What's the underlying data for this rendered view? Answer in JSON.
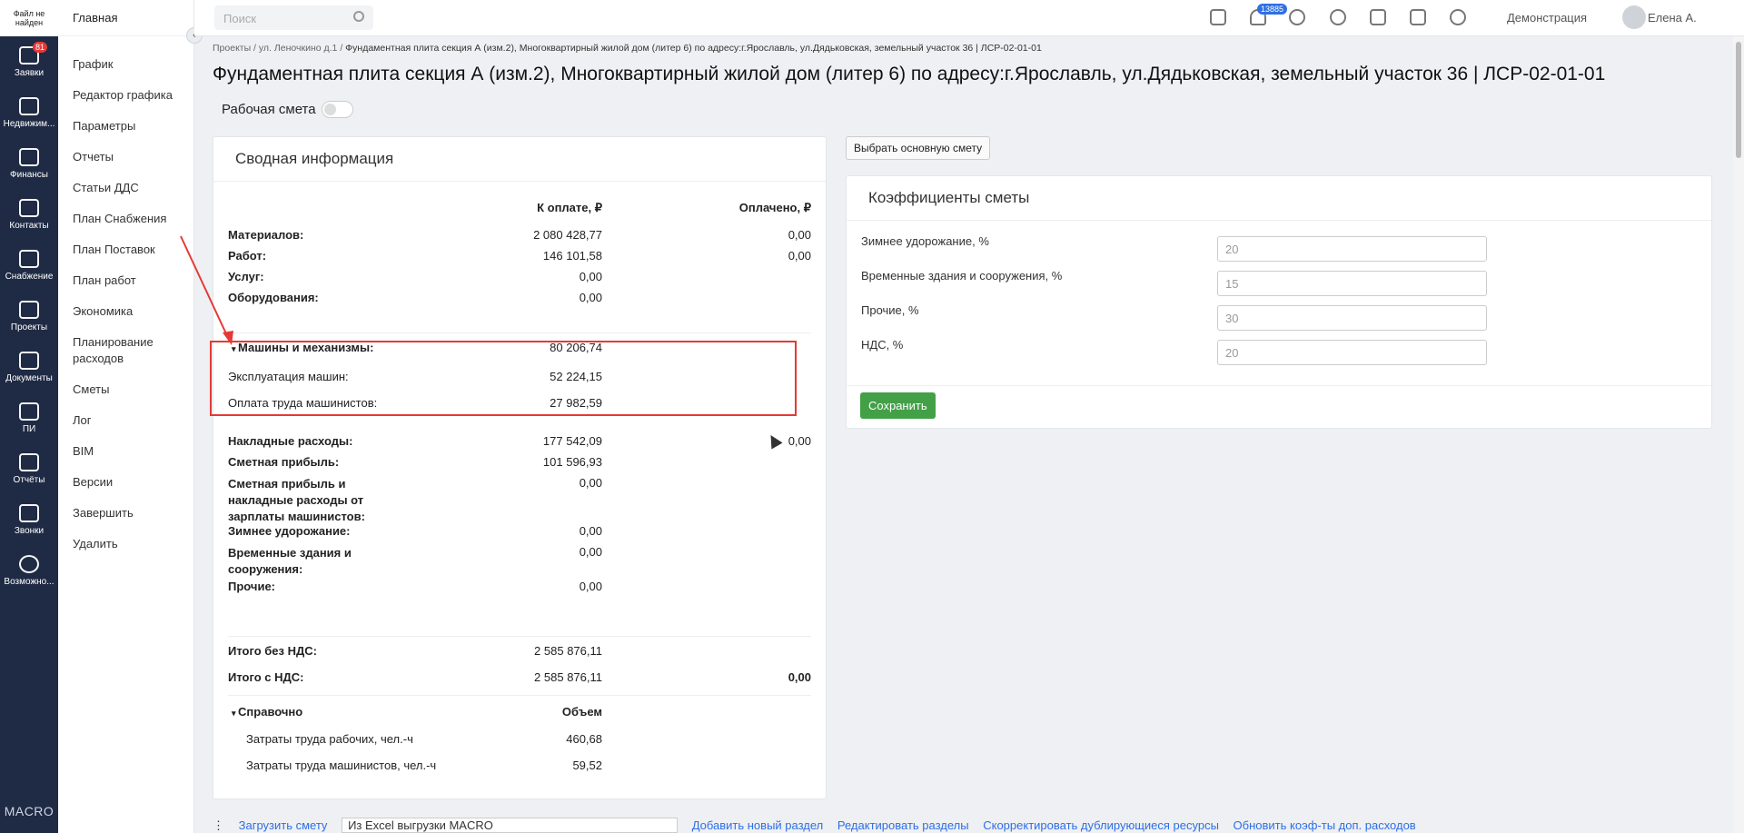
{
  "rail": {
    "file_notice": "Файл не найден",
    "items": [
      {
        "label": "Заявки",
        "badge": "81"
      },
      {
        "label": "Недвижим..."
      },
      {
        "label": "Финансы"
      },
      {
        "label": "Контакты"
      },
      {
        "label": "Снабжение"
      },
      {
        "label": "Проекты"
      },
      {
        "label": "Документы"
      },
      {
        "label": "ПИ"
      },
      {
        "label": "Отчёты"
      },
      {
        "label": "Звонки"
      },
      {
        "label": "Возможно..."
      }
    ],
    "brand": "MACRO"
  },
  "sidebar": {
    "title": "Главная",
    "items": [
      "График",
      "Редактор графика",
      "Параметры",
      "Отчеты",
      "Статьи ДДС",
      "План Снабжения",
      "План Поставок",
      "План работ",
      "Экономика",
      "Планирование расходов",
      "Сметы",
      "Лог",
      "BIM",
      "Версии",
      "Завершить",
      "Удалить"
    ]
  },
  "topbar": {
    "search_placeholder": "Поиск",
    "notif_count": "13885",
    "org": "Демонстрация",
    "user": "Елена А."
  },
  "breadcrumb": {
    "items": [
      "Проекты",
      "ул. Леночкино д.1",
      "Фундаментная плита секция А (изм.2), Многоквартирный жилой дом (литер 6) по адресу:г.Ярославль, ул.Дядьковская, земельный участок 36 | ЛСР-02-01-01"
    ]
  },
  "page_title": "Фундаментная плита секция А (изм.2), Многоквартирный жилой дом (литер 6) по адресу:г.Ярославль, ул.Дядьковская, земельный участок 36 | ЛСР-02-01-01",
  "working_estimate": {
    "label": "Рабочая смета",
    "enabled": false
  },
  "summary": {
    "title": "Сводная информация",
    "col_pay": "К оплате, ₽",
    "col_paid": "Оплачено, ₽",
    "rows": [
      {
        "label": "Материалов:",
        "pay": "2 080 428,77",
        "paid": "0,00"
      },
      {
        "label": "Работ:",
        "pay": "146 101,58",
        "paid": "0,00"
      },
      {
        "label": "Услуг:",
        "pay": "0,00",
        "paid": ""
      },
      {
        "label": "Оборудования:",
        "pay": "0,00",
        "paid": ""
      }
    ],
    "machines": {
      "label": "Машины и механизмы:",
      "pay": "80 206,74",
      "sub": [
        {
          "label": "Эксплуатация машин:",
          "pay": "52 224,15"
        },
        {
          "label": "Оплата труда машинистов:",
          "pay": "27 982,59"
        }
      ]
    },
    "rows2": [
      {
        "label": "Накладные расходы:",
        "pay": "177 542,09",
        "paid": "0,00"
      },
      {
        "label": "Сметная прибыль:",
        "pay": "101 596,93",
        "paid": ""
      },
      {
        "label": "Сметная прибыль и накладные расходы от зарплаты машинистов:",
        "pay": "0,00",
        "paid": ""
      },
      {
        "label": "Зимнее удорожание:",
        "pay": "0,00",
        "paid": ""
      },
      {
        "label": "Временные здания и сооружения:",
        "pay": "0,00",
        "paid": ""
      },
      {
        "label": "Прочие:",
        "pay": "0,00",
        "paid": ""
      }
    ],
    "total_no_vat": {
      "label": "Итого без НДС:",
      "pay": "2 585 876,11"
    },
    "total_vat": {
      "label": "Итого с НДС:",
      "pay": "2 585 876,11",
      "paid": "0,00"
    },
    "ref": {
      "label": "Справочно",
      "col": "Объем",
      "rows": [
        {
          "label": "Затраты труда рабочих, чел.-ч",
          "val": "460,68"
        },
        {
          "label": "Затраты труда машинистов, чел.-ч",
          "val": "59,52"
        }
      ]
    }
  },
  "select_main_btn": "Выбрать основную смету",
  "coefficients": {
    "title": "Коэффициенты сметы",
    "fields": [
      {
        "label": "Зимнее удорожание, %",
        "value": "20"
      },
      {
        "label": "Временные здания и сооружения, %",
        "value": "15"
      },
      {
        "label": "Прочие, %",
        "value": "30"
      },
      {
        "label": "НДС, %",
        "value": "20"
      }
    ],
    "save": "Сохранить"
  },
  "bottom": {
    "upload": "Загрузить смету",
    "source": "Из Excel выгрузки MACRO",
    "add_section": "Добавить новый раздел",
    "edit_sections": "Редактировать разделы",
    "fix_dupes": "Скорректировать дублирующиеся ресурсы",
    "update_coef": "Обновить коэф-ты доп. расходов"
  }
}
